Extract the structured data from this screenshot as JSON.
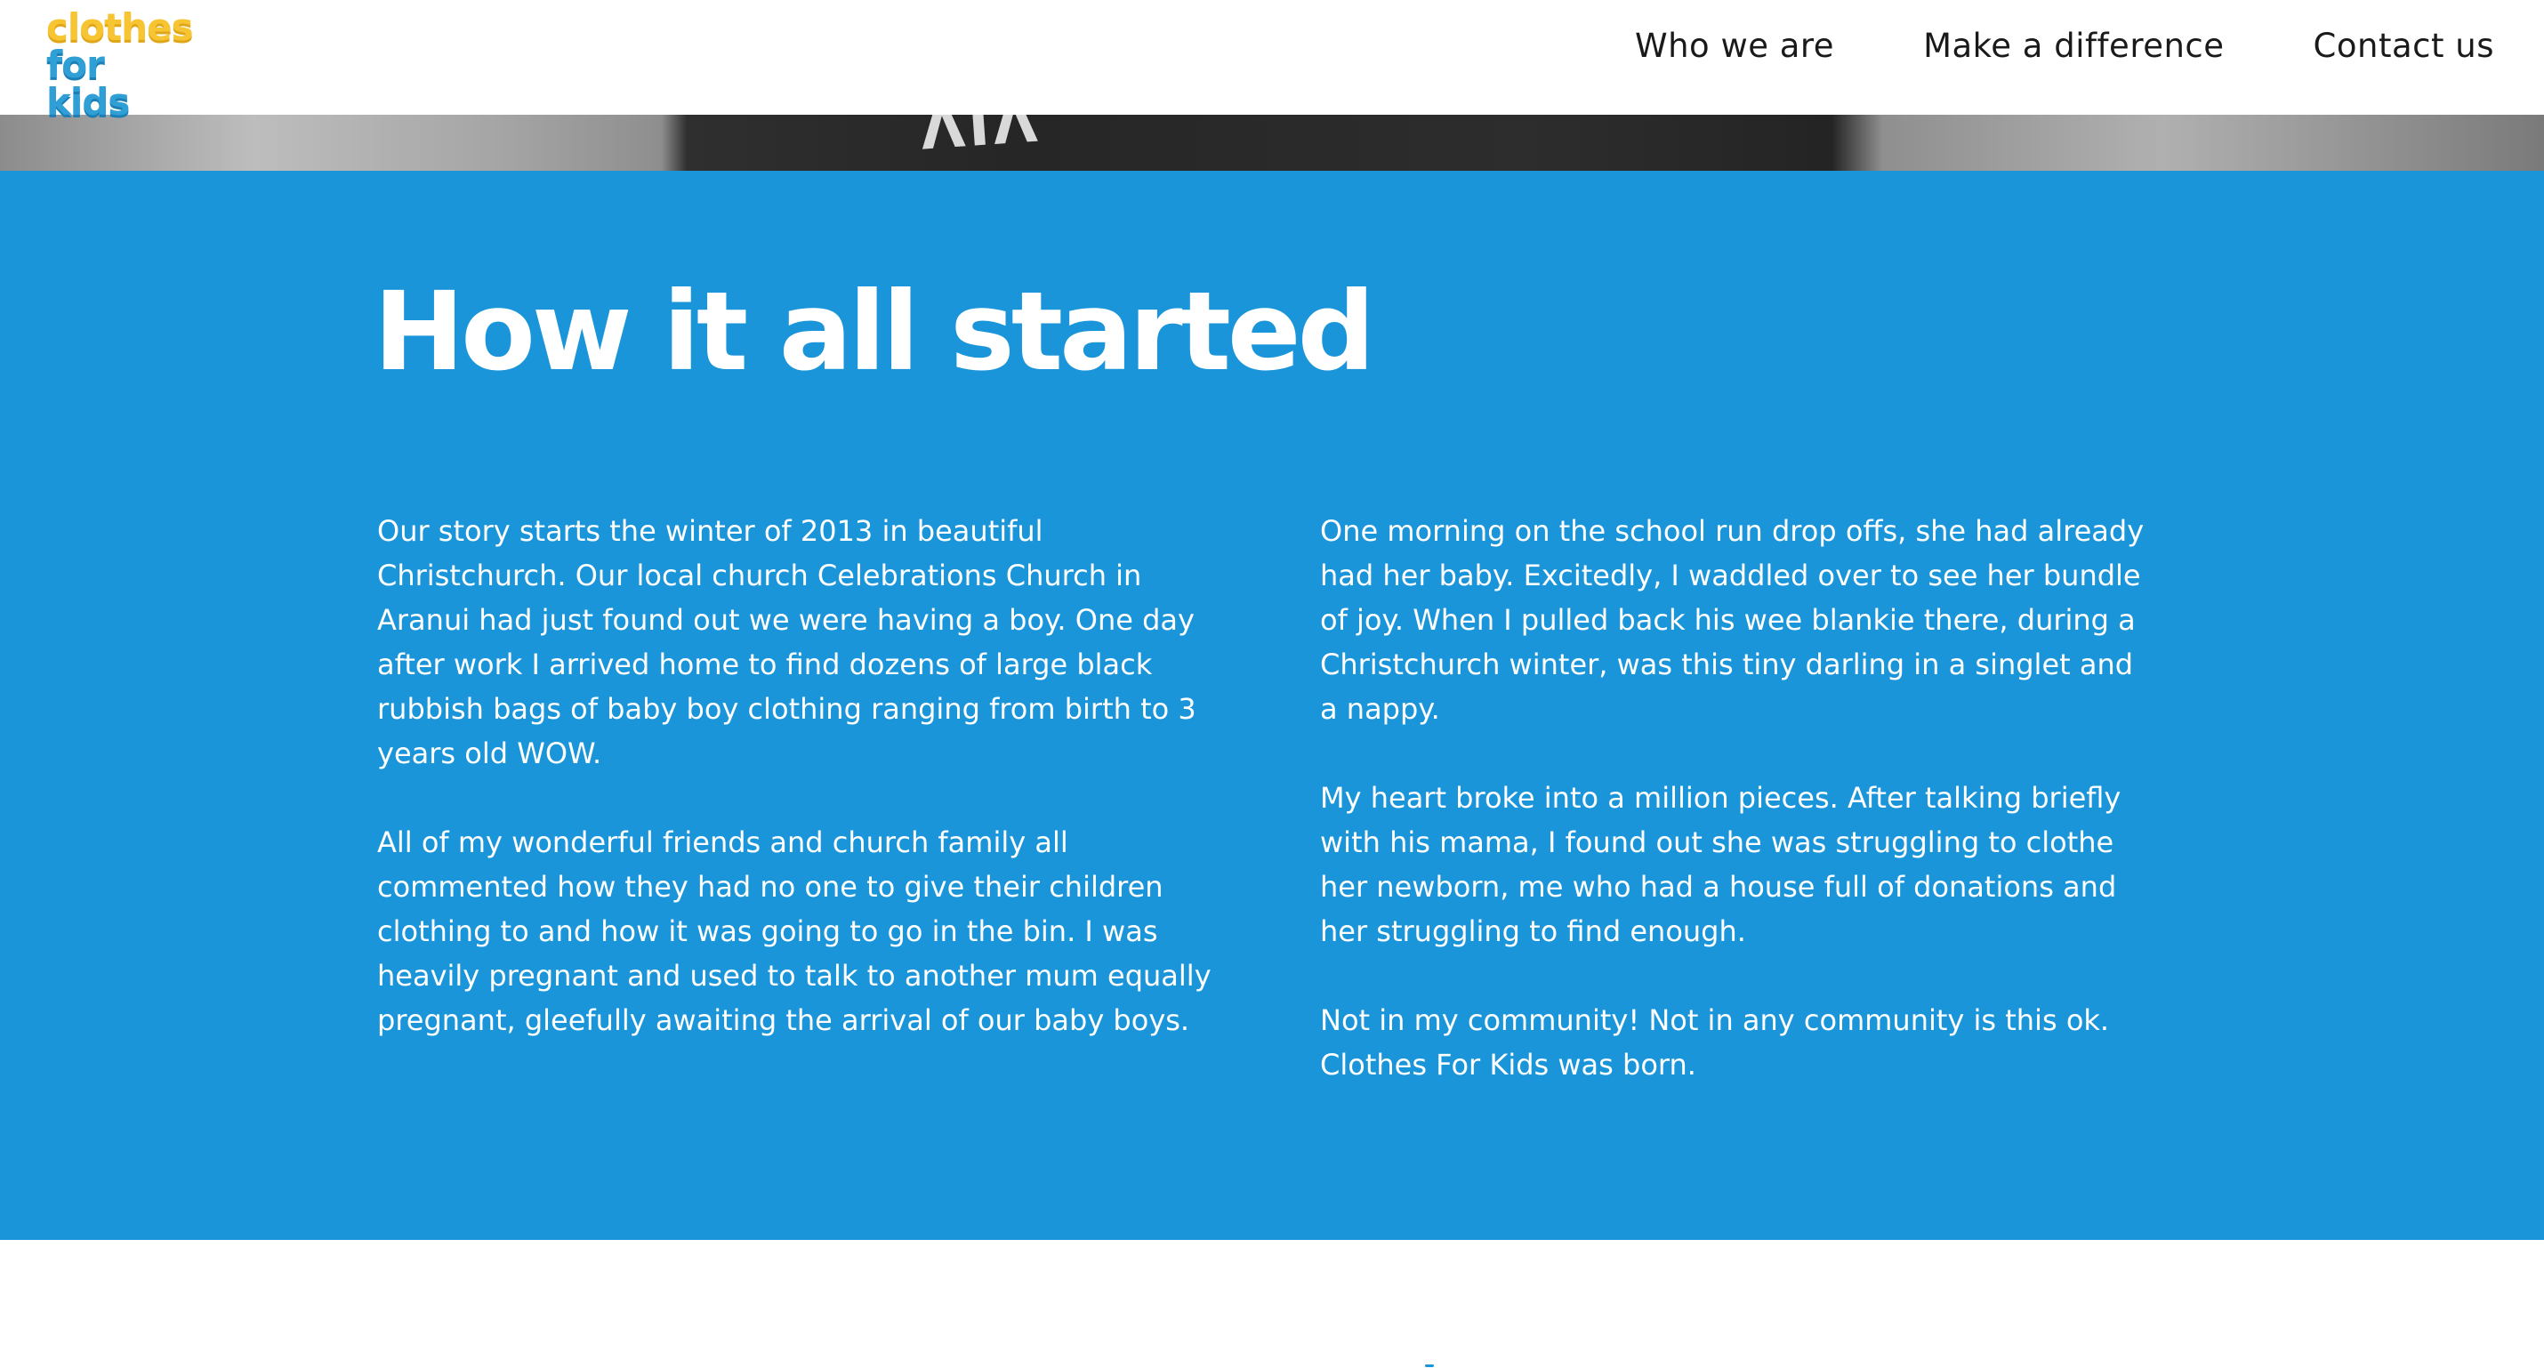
{
  "header": {
    "logo": {
      "line1": "clothes",
      "line2": "for kids",
      "colors": {
        "primary": "#f7c531",
        "secondary": "#2f9fd6"
      }
    },
    "nav": [
      {
        "label": "Who we are"
      },
      {
        "label": "Make a difference"
      },
      {
        "label": "Contact us"
      }
    ]
  },
  "story": {
    "title": "How it all started",
    "background_color": "#1a95d9",
    "left_paragraphs": [
      "Our story starts the winter of 2013 in beautiful Christchurch. Our local church Celebrations Church in Aranui had just found out we were having a boy. One day after work I arrived home to find dozens of large black rubbish bags of baby boy clothing ranging from birth to 3 years old WOW.",
      "All of my wonderful friends and church family all commented how they had no one to give their children clothing to and how it was going to go in the bin. I was heavily pregnant and used to talk to another mum equally pregnant, gleefully awaiting the arrival of our baby boys."
    ],
    "right_paragraphs": [
      "One morning on the school run drop offs, she had already had her baby. Excitedly, I waddled over to see her bundle of joy. When I pulled back his wee blankie there, during a Christchurch winter, was this tiny darling in a singlet and a nappy.",
      "My heart broke into a million pieces. After talking briefly with his mama, I found out she was struggling to clothe her newborn, me who had a house full of donations and her struggling to find enough.",
      "Not in my community! Not in any community is this ok. Clothes For Kids was born."
    ]
  }
}
